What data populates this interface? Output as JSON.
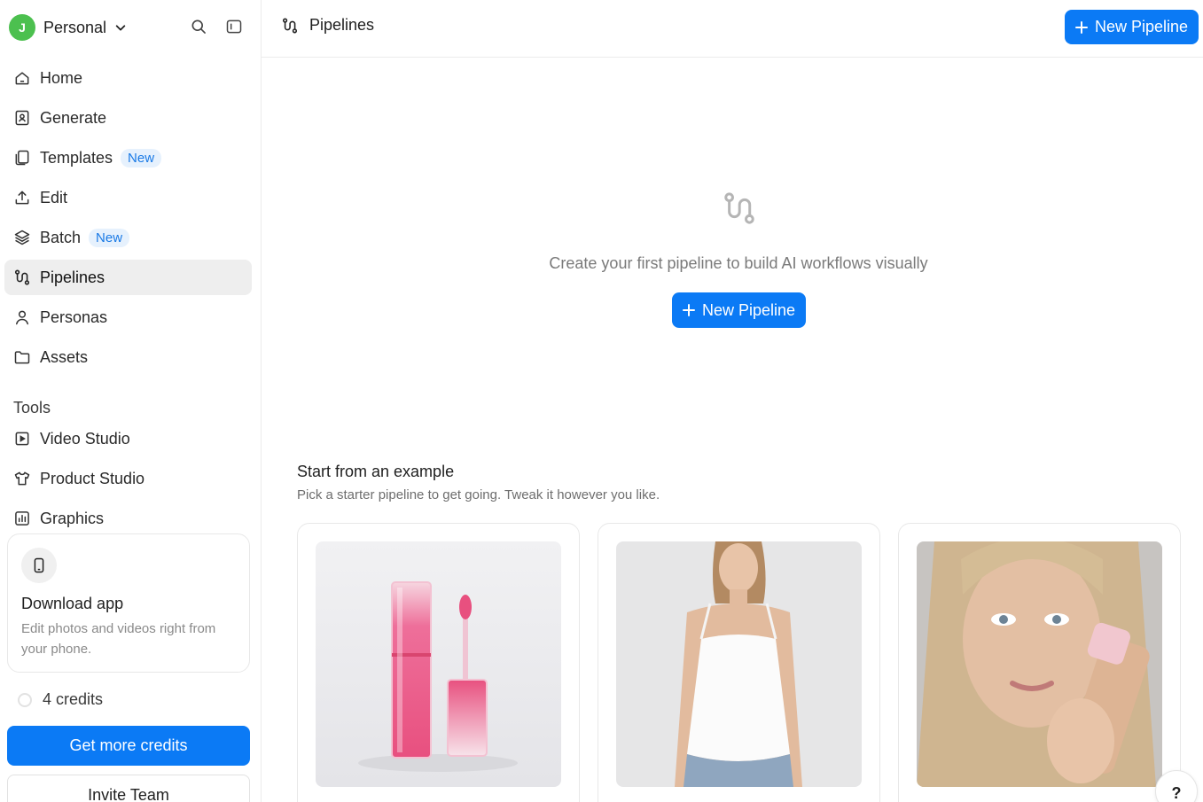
{
  "workspace": {
    "avatar_letter": "J",
    "name": "Personal",
    "avatar_color": "#4cc04f"
  },
  "nav": {
    "items": [
      {
        "label": "Home",
        "icon": "home-icon"
      },
      {
        "label": "Generate",
        "icon": "generate-icon"
      },
      {
        "label": "Templates",
        "icon": "templates-icon",
        "badge": "New"
      },
      {
        "label": "Edit",
        "icon": "upload-icon"
      },
      {
        "label": "Batch",
        "icon": "layers-icon",
        "badge": "New"
      },
      {
        "label": "Pipelines",
        "icon": "pipeline-icon",
        "active": true
      },
      {
        "label": "Personas",
        "icon": "user-icon"
      },
      {
        "label": "Assets",
        "icon": "folder-icon"
      }
    ]
  },
  "tools": {
    "heading": "Tools",
    "items": [
      {
        "label": "Video Studio",
        "icon": "video-icon"
      },
      {
        "label": "Product Studio",
        "icon": "shirt-icon"
      },
      {
        "label": "Graphics",
        "icon": "chart-icon"
      }
    ]
  },
  "download_app": {
    "title": "Download app",
    "text": "Edit photos and videos right from your phone."
  },
  "credits": {
    "label": "4 credits",
    "button": "Get more credits"
  },
  "invite": {
    "label": "Invite Team"
  },
  "header": {
    "title": "Pipelines",
    "new_button": "New Pipeline"
  },
  "empty_state": {
    "text": "Create your first pipeline to build AI workflows visually",
    "button": "New Pipeline"
  },
  "examples": {
    "title": "Start from an example",
    "subtitle": "Pick a starter pipeline to get going. Tweak it however you like.",
    "cards": [
      {
        "image": "pink-lip-gloss-product-photo"
      },
      {
        "image": "woman-white-camisole-photo"
      },
      {
        "image": "woman-holding-foundation-bottle-photo"
      }
    ]
  },
  "help": {
    "label": "?"
  },
  "colors": {
    "accent": "#0b7af5",
    "badge_text": "#1a7ae6",
    "badge_bg": "#e6f1fd"
  }
}
